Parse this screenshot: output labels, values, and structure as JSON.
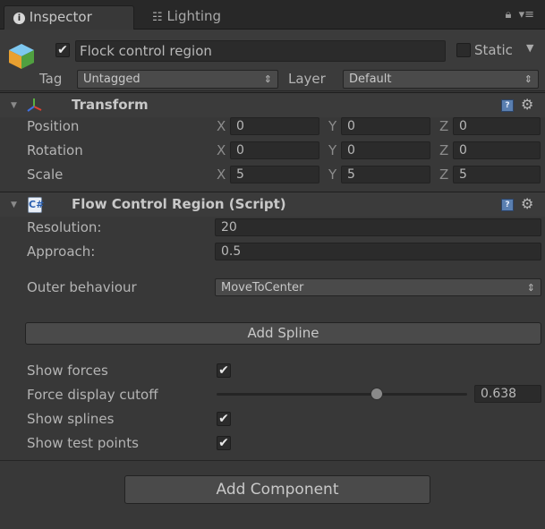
{
  "tabs": {
    "inspector": {
      "icon": "info-icon",
      "label": "Inspector"
    },
    "lighting": {
      "icon": "lighting-icon",
      "label": "Lighting"
    },
    "right": {
      "lock": "lock-icon",
      "menu": "menu-icon"
    }
  },
  "object": {
    "active": true,
    "name": "Flock control region",
    "static_label": "Static",
    "static_checked": false,
    "tag_label": "Tag",
    "tag_value": "Untagged",
    "layer_label": "Layer",
    "layer_value": "Default"
  },
  "transform": {
    "title": "Transform",
    "rows": [
      {
        "label": "Position",
        "x": "0",
        "y": "0",
        "z": "0"
      },
      {
        "label": "Rotation",
        "x": "0",
        "y": "0",
        "z": "0"
      },
      {
        "label": "Scale",
        "x": "5",
        "y": "5",
        "z": "5"
      }
    ],
    "axes": {
      "x": "X",
      "y": "Y",
      "z": "Z"
    }
  },
  "script": {
    "title": "Flow Control Region (Script)",
    "resolution_label": "Resolution:",
    "resolution_value": "20",
    "approach_label": "Approach:",
    "approach_value": "0.5",
    "outer_label": "Outer behaviour",
    "outer_value": "MoveToCenter",
    "add_spline_label": "Add Spline",
    "show_forces_label": "Show forces",
    "show_forces": true,
    "cutoff_label": "Force display cutoff",
    "cutoff_value": "0.638",
    "cutoff_fraction": 0.638,
    "show_splines_label": "Show splines",
    "show_splines": true,
    "show_test_points_label": "Show test points",
    "show_test_points": true
  },
  "add_component_label": "Add Component",
  "colors": {
    "background": "#383838",
    "tabbar": "#282828",
    "field": "#2b2b2b",
    "text": "#b4b4b4"
  }
}
